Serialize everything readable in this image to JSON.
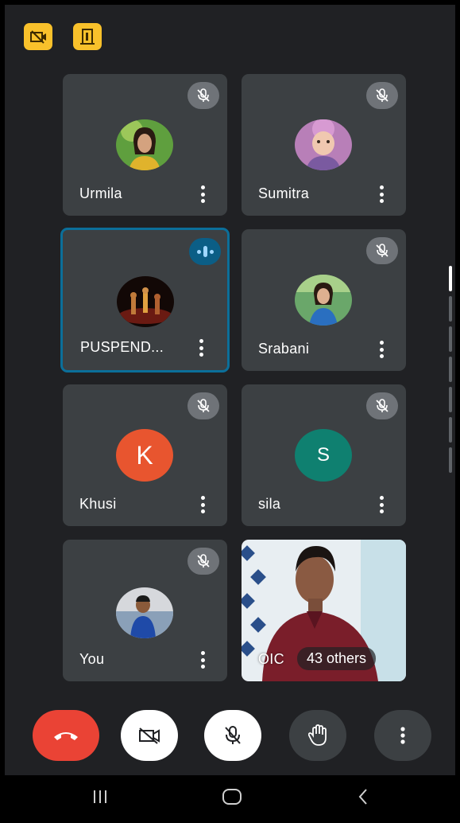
{
  "participants": [
    {
      "name": "Urmila"
    },
    {
      "name": "Sumitra"
    },
    {
      "name": "PUSPEND..."
    },
    {
      "name": "Srabani"
    },
    {
      "name": "Khusi",
      "initial": "K",
      "avatar_color": "#e8552f"
    },
    {
      "name": "sila",
      "initial": "S",
      "avatar_color": "#0f8070"
    },
    {
      "name": "You"
    },
    {
      "name": "OIC",
      "others_label": "43 others"
    }
  ],
  "colors": {
    "background": "#202124",
    "tile": "#3c4043",
    "end_call": "#ea4335",
    "active_speaker_border": "#0b6f9a",
    "top_badge": "#f9c12b"
  },
  "icons": {
    "top_left": [
      "no-camera-icon",
      "exit-room-icon"
    ],
    "tile_status": "mic-off-icon",
    "active_speaker": "speaking-icon",
    "controls": [
      "end-call-icon",
      "camera-off-icon",
      "mic-off-icon",
      "raise-hand-icon",
      "more-vert-icon"
    ],
    "nav": [
      "recent-apps-icon",
      "home-icon",
      "back-icon"
    ]
  }
}
